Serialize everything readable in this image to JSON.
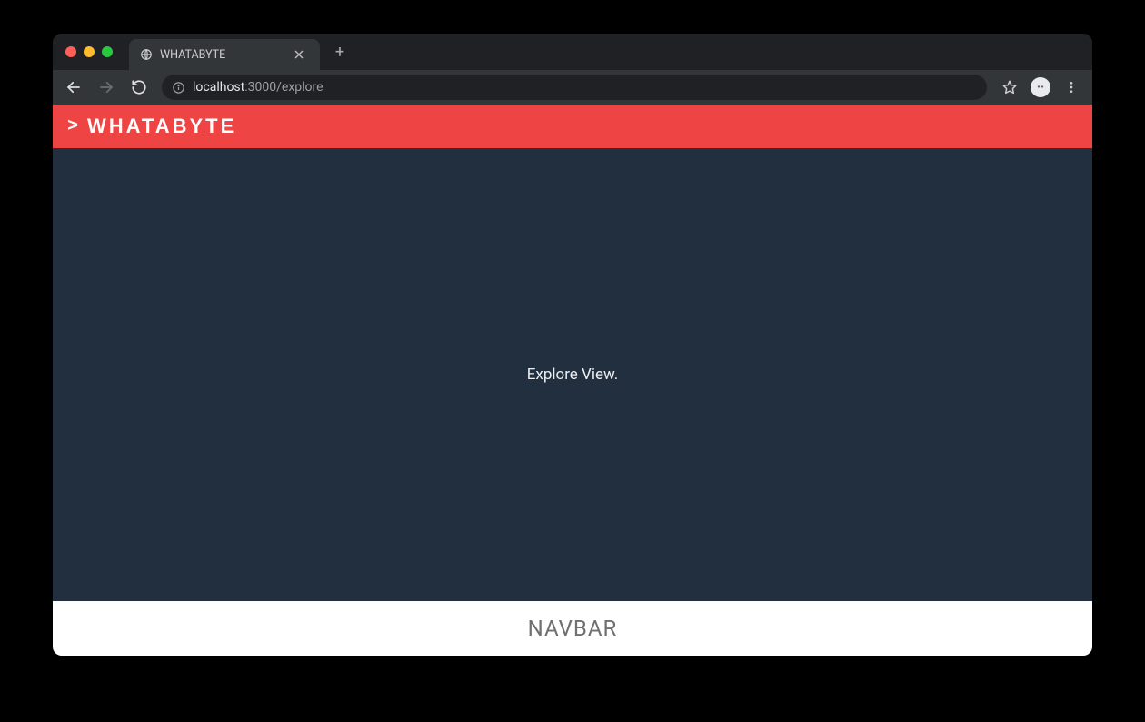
{
  "browser": {
    "tab_title": "WHATABYTE",
    "url_host": "localhost",
    "url_port_path": ":3000/explore",
    "new_tab_symbol": "+"
  },
  "app": {
    "header_prompt": ">",
    "header_title": "WHATABYTE",
    "main_text": "Explore View.",
    "footer_text": "NAVBAR"
  },
  "colors": {
    "accent_red": "#ee4443",
    "app_bg": "#222f3e",
    "footer_text": "#707070"
  }
}
